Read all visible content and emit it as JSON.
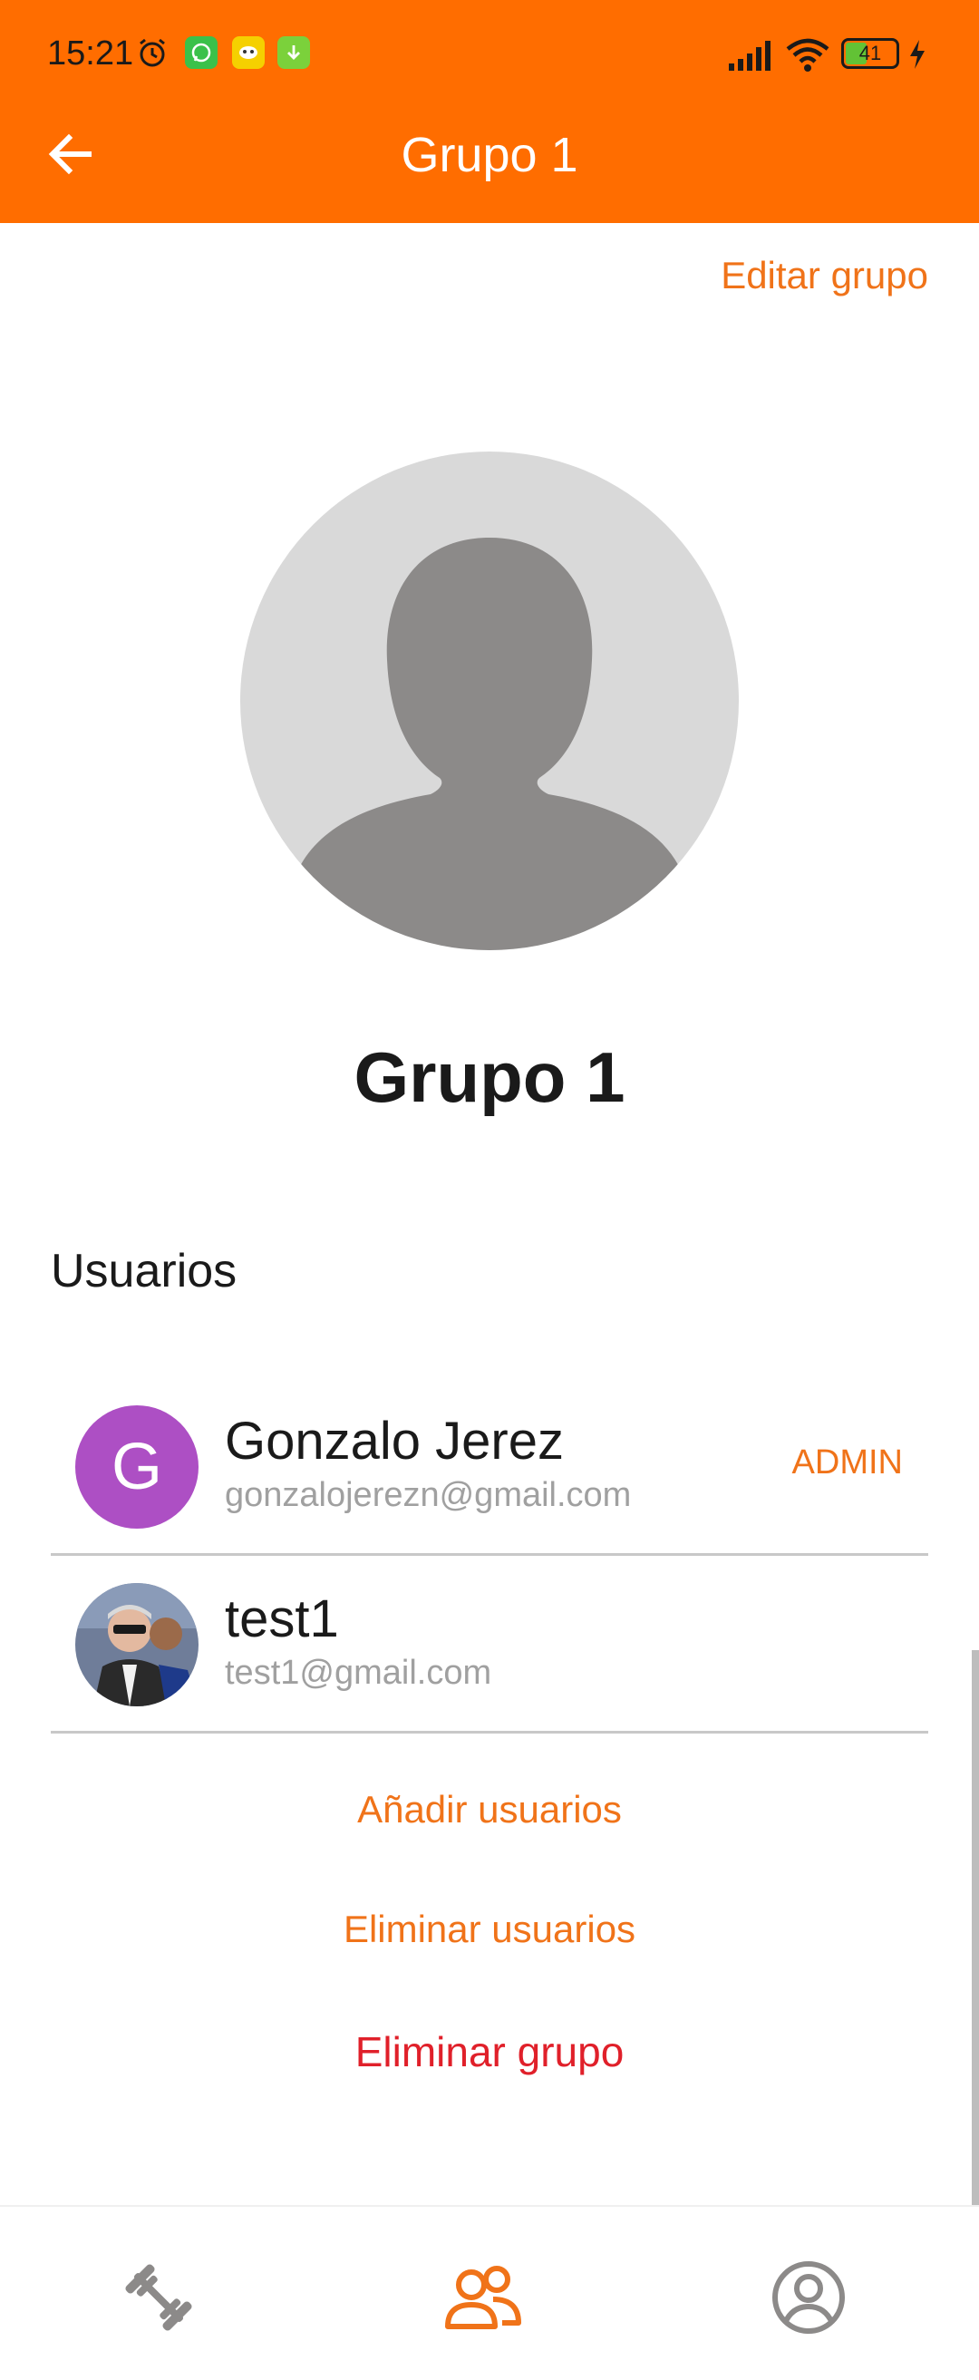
{
  "status_bar": {
    "time": "15:21",
    "battery": "41",
    "icons": [
      "alarm-icon",
      "whatsapp-icon",
      "notification-icon",
      "download-icon",
      "signal-icon",
      "wifi-icon",
      "battery-icon",
      "charging-icon"
    ]
  },
  "app_bar": {
    "title": "Grupo 1",
    "background": "#ff6d00"
  },
  "edit_label": "Editar grupo",
  "group": {
    "name": "Grupo 1"
  },
  "members_section": {
    "title": "Usuarios",
    "users": [
      {
        "initial": "G",
        "name": "Gonzalo Jerez",
        "email": "gonzalojerezn@gmail.com",
        "badge": "ADMIN"
      },
      {
        "initial": "",
        "name": "test1",
        "email": "test1@gmail.com",
        "badge": ""
      }
    ]
  },
  "actions": {
    "add_users": "Añadir usuarios",
    "remove_users": "Eliminar usuarios",
    "delete_group": "Eliminar grupo"
  },
  "bottom_nav": {
    "items": [
      "workout-icon",
      "group-icon",
      "profile-icon"
    ],
    "active_index": 1
  },
  "colors": {
    "accent": "#f07319",
    "danger": "#e0202a",
    "avatar_purple": "#ad4fc4"
  }
}
